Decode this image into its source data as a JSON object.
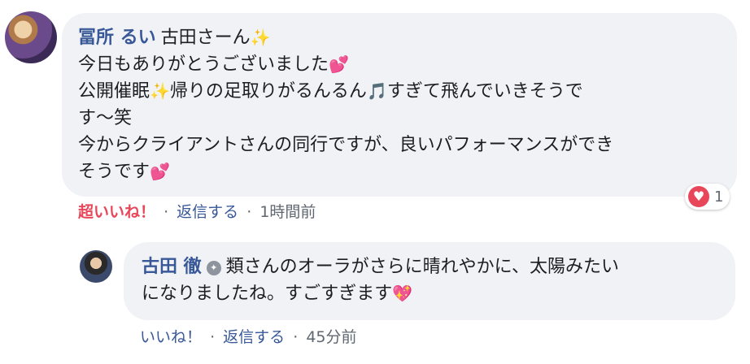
{
  "comment": {
    "author": "冨所 るい",
    "lines": [
      "古田さーん",
      "今日もありがとうございました",
      "公開催眠",
      "帰りの足取りがるんるん",
      "すぎて飛んでいきそうで",
      "す〜笑",
      "今からクライアントさんの同行ですが、良いパフォーマンスができ",
      "そうです"
    ],
    "icons": [
      "sparkles-icon",
      "two-hearts-icon",
      "sparkles-icon",
      "music-note-icon",
      "two-hearts-icon"
    ],
    "reaction_count": "1",
    "meta": {
      "like_label": "超いいね！",
      "reply_label": "返信する",
      "time": "1時間前"
    }
  },
  "reply": {
    "author": "古田 徹",
    "lines": [
      "類さんのオーラがさらに晴れやかに、太陽みたい",
      "になりましたね。すごすぎます"
    ],
    "icons": [
      "shield-badge-icon",
      "sparkling-heart-icon"
    ],
    "meta": {
      "like_label": "いいね！",
      "reply_label": "返信する",
      "time": "45分前"
    }
  },
  "colors": {
    "name": "#385898",
    "super_like": "#e8475a",
    "bubble": "#f0f2f5",
    "meta": "#606770"
  }
}
